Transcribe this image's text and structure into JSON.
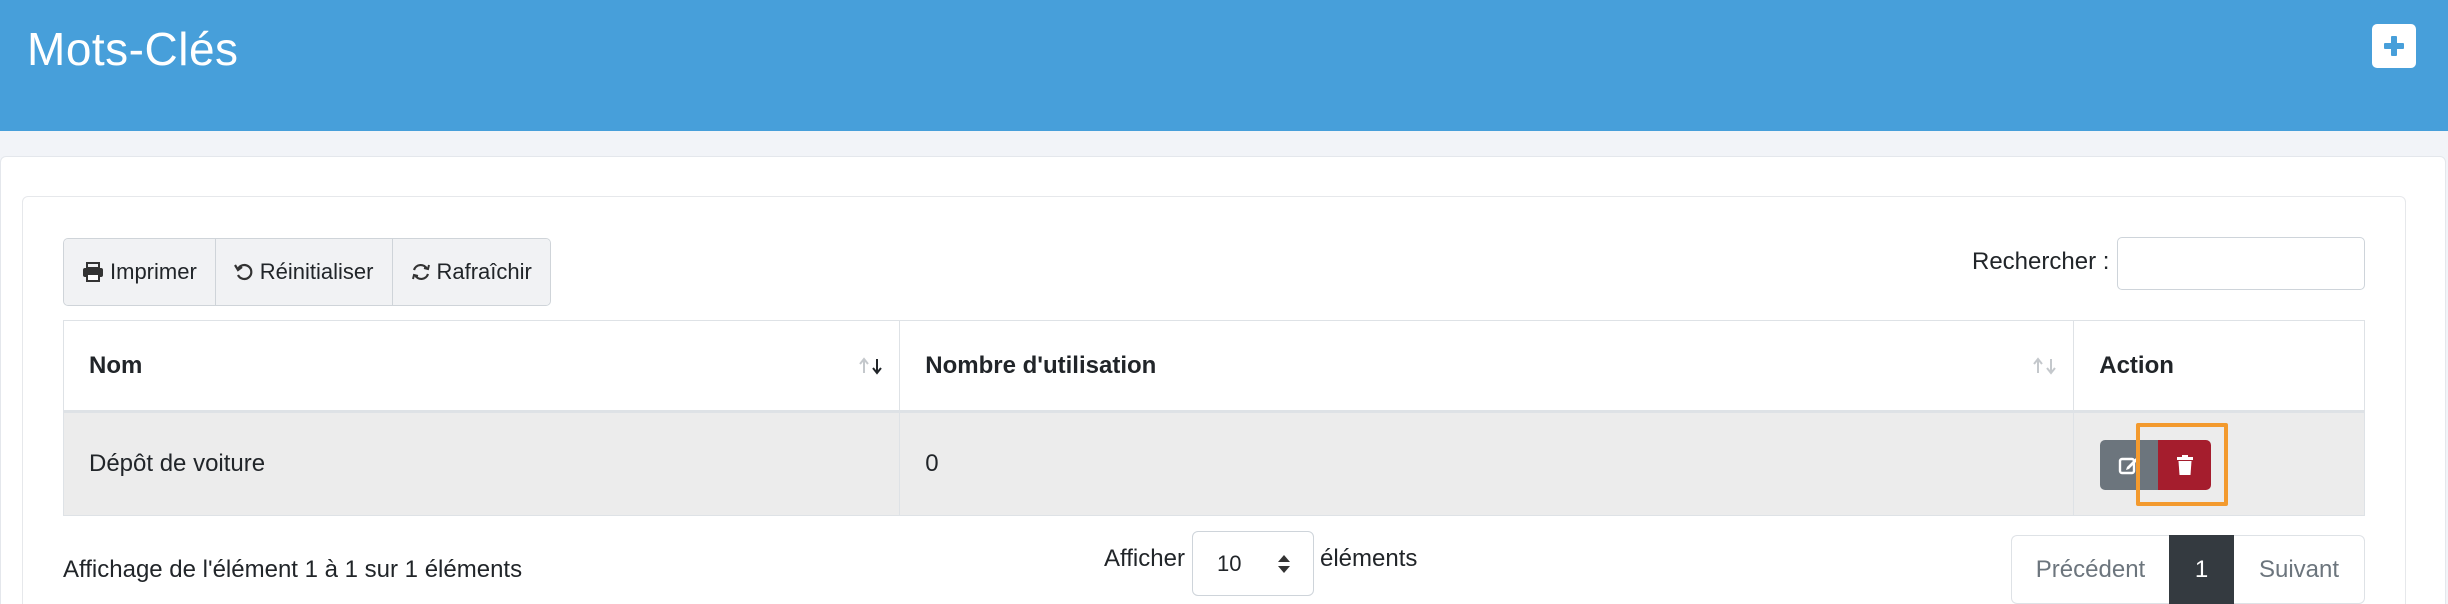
{
  "header": {
    "title": "Mots-Clés",
    "add_icon": "plus-icon"
  },
  "toolbar": {
    "print_label": "Imprimer",
    "reset_label": "Réinitialiser",
    "refresh_label": "Rafraîchir"
  },
  "search": {
    "label": "Rechercher :",
    "value": ""
  },
  "table": {
    "columns": [
      "Nom",
      "Nombre d'utilisation",
      "Action"
    ],
    "rows": [
      {
        "nom": "Dépôt de voiture",
        "nombre": "0"
      }
    ]
  },
  "actions": {
    "edit_icon": "edit-icon",
    "delete_icon": "trash-icon",
    "highlight_color": "#f39a2e"
  },
  "footer": {
    "info": "Affichage de l'élément 1 à 1 sur 1 éléments",
    "length_prefix": "Afficher",
    "length_value": "10",
    "length_suffix": "éléments"
  },
  "pagination": {
    "previous": "Précédent",
    "current": "1",
    "next": "Suivant"
  },
  "colors": {
    "header_bg": "#479fda",
    "delete_btn": "#a51d2d",
    "edit_btn": "#6c757d",
    "active_page": "#343a40"
  }
}
